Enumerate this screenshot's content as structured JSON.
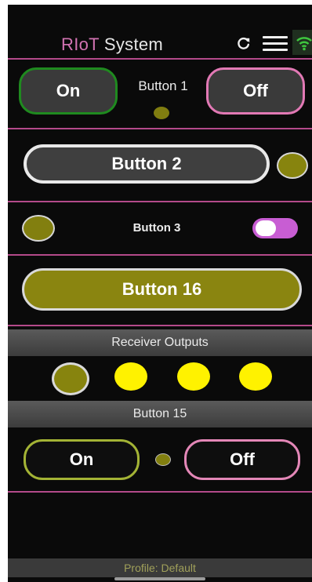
{
  "header": {
    "title_brand": "RIoT",
    "title_rest": " System",
    "icons": [
      "refresh-icon",
      "menu-icon",
      "wifi-icon"
    ]
  },
  "row1": {
    "on_label": "On",
    "name_label": "Button 1",
    "off_label": "Off"
  },
  "row2": {
    "label": "Button 2"
  },
  "row3": {
    "label": "Button 3",
    "toggle_on": true
  },
  "row4": {
    "label": "Button 16"
  },
  "receiver": {
    "title": "Receiver Outputs",
    "outputs": [
      "on",
      "off",
      "off",
      "off"
    ]
  },
  "row15": {
    "title": "Button 15",
    "on_label": "On",
    "off_label": "Off"
  },
  "footer": {
    "profile": "Profile: Default"
  },
  "colors": {
    "accent_pink": "#d273b2",
    "divider": "#b44a8a",
    "led_dark": "#87840e",
    "led_bright": "#fff200",
    "on_green": "#1f8a1f",
    "on_olive": "#a3b335",
    "toggle": "#c85dd3"
  }
}
